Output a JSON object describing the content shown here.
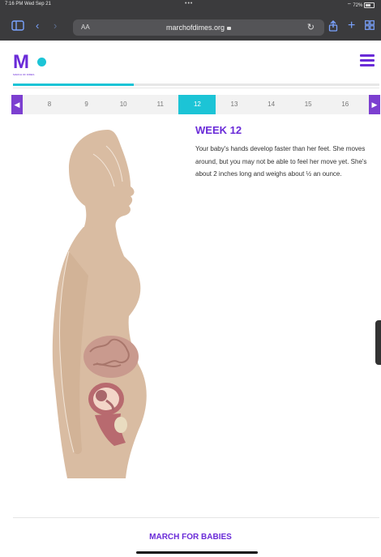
{
  "status": {
    "time_date": "7:16 PM  Wed Sep 21",
    "dots": "•••",
    "wifi_battery": "72%"
  },
  "browser": {
    "aa_label": "AA",
    "url": "marchofdimes.org"
  },
  "logo": {
    "mark": "M",
    "subtitle": "MARCH OF DIMES"
  },
  "progress": {
    "fraction": 0.33
  },
  "weeks": [
    "8",
    "9",
    "10",
    "11",
    "12",
    "13",
    "14",
    "15",
    "16"
  ],
  "active_week": "12",
  "content": {
    "title": "WEEK 12",
    "description": "Your baby's hands develop faster than her feet. She moves around, but you may not be able to feel her move yet. She's about 2 inches long and weighs about ½ an ounce."
  },
  "footer": {
    "link": "MARCH FOR BABIES"
  },
  "colors": {
    "brand_purple": "#6a2bd8",
    "accent_teal": "#1cc4d6",
    "skin": "#d9bca2"
  }
}
